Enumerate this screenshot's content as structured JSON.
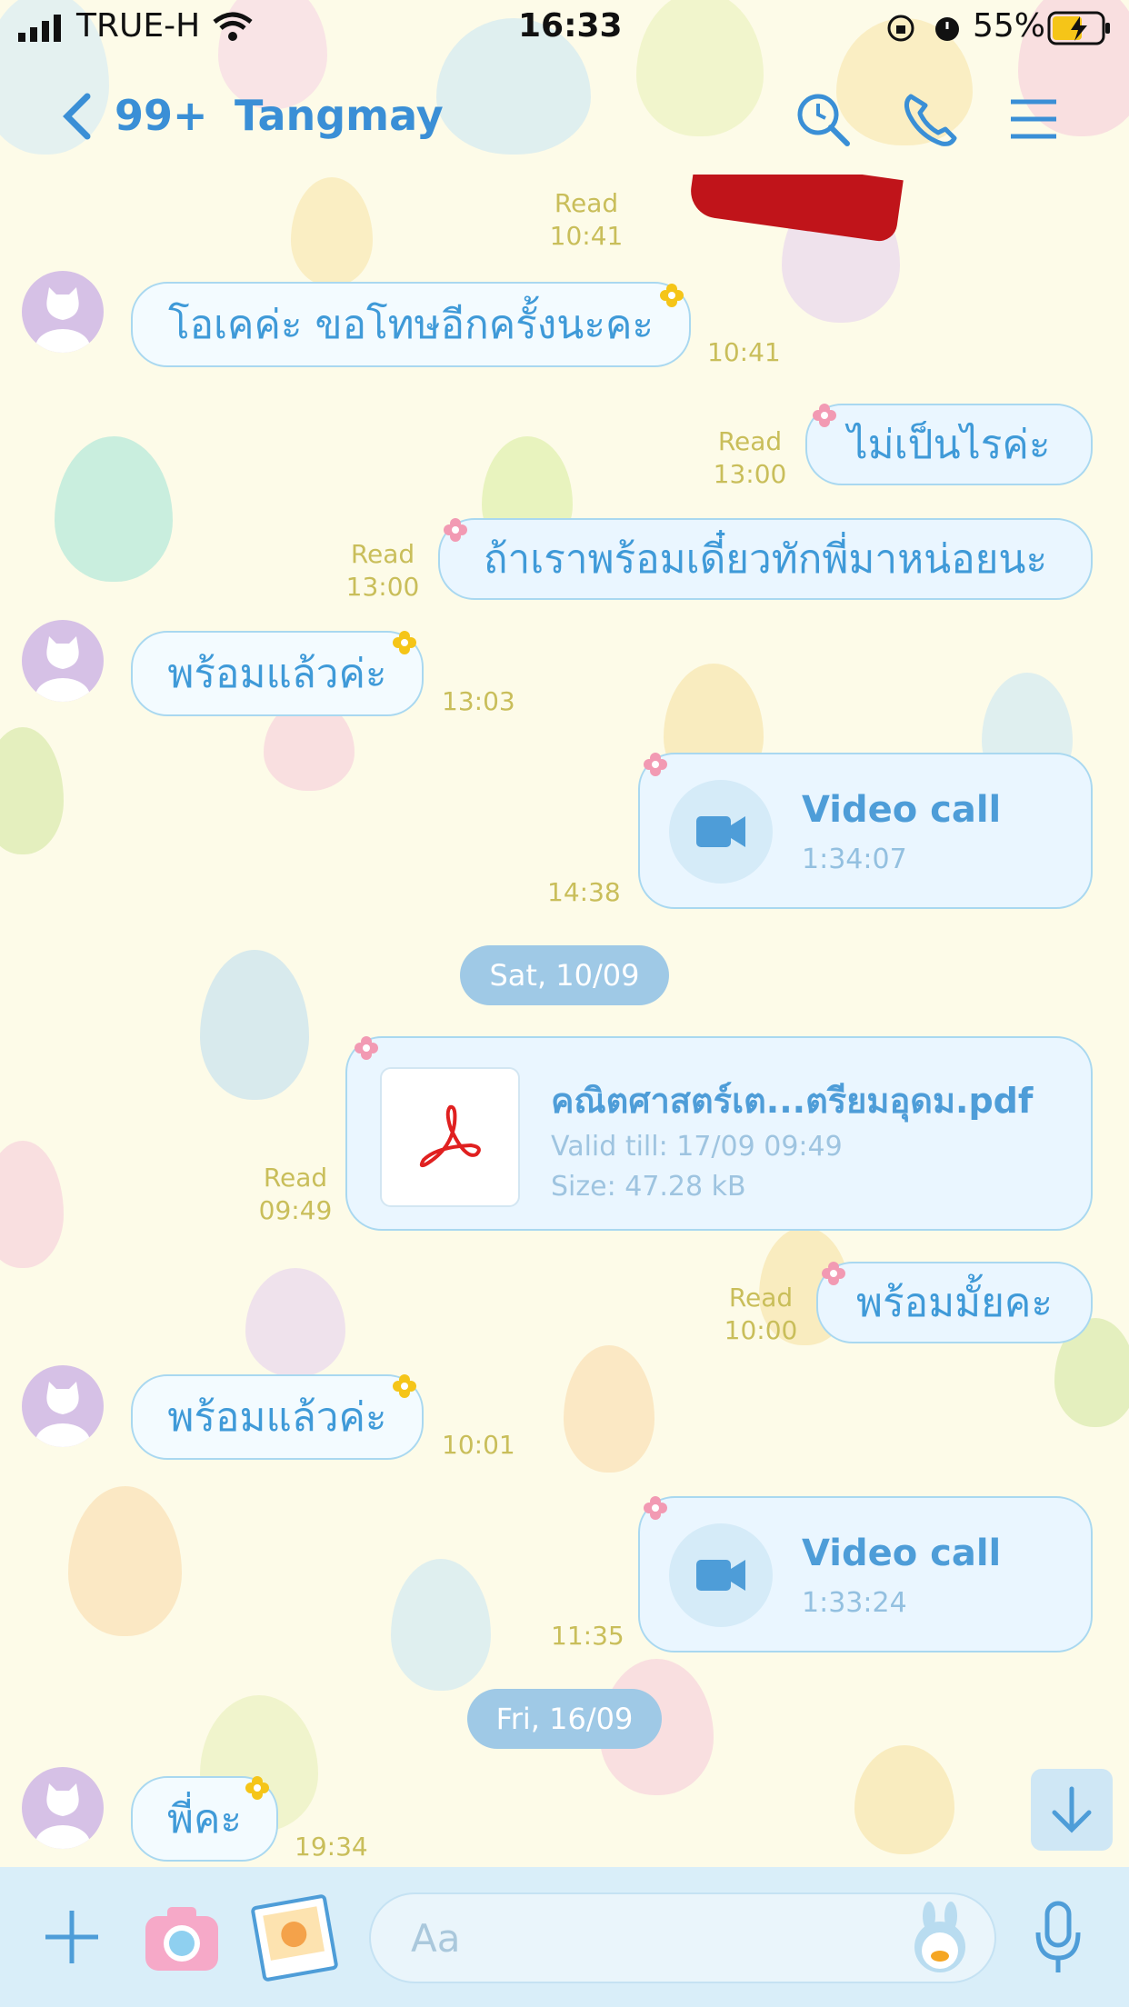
{
  "status_bar": {
    "carrier": "TRUE-H",
    "time": "16:33",
    "battery": "55%"
  },
  "header": {
    "back_count": "99+",
    "contact_name": "Tangmay",
    "icons": [
      "search-icon",
      "phone-icon",
      "menu-icon"
    ]
  },
  "messages": {
    "m1": {
      "read": "Read",
      "time": "10:41"
    },
    "m2": {
      "text": "โอเคค่ะ ขอโทษอีกครั้งนะคะ",
      "time": "10:41"
    },
    "m3": {
      "text": "ไม่เป็นไรค่ะ",
      "read": "Read",
      "time": "13:00"
    },
    "m4": {
      "text": "ถ้าเราพร้อมเดี๋ยวทักพี่มาหน่อยนะ",
      "read": "Read",
      "time": "13:00"
    },
    "m5": {
      "text": "พร้อมแล้วค่ะ",
      "time": "13:03"
    },
    "m6": {
      "title": "Video call",
      "duration": "1:34:07",
      "time": "14:38"
    },
    "date1": "Sat, 10/09",
    "m7": {
      "file_name": "คณิตศาสตร์เต...ตรียมอุดม.pdf",
      "valid": "Valid till: 17/09 09:49",
      "size": "Size: 47.28 kB",
      "read": "Read",
      "time": "09:49"
    },
    "m8": {
      "text": "พร้อมมั้ยคะ",
      "read": "Read",
      "time": "10:00"
    },
    "m9": {
      "text": "พร้อมแล้วค่ะ",
      "time": "10:01"
    },
    "m10": {
      "title": "Video call",
      "duration": "1:33:24",
      "time": "11:35"
    },
    "date2": "Fri, 16/09",
    "m11": {
      "text": "พี่คะ",
      "time": "19:34"
    }
  },
  "input": {
    "placeholder": "Aa"
  },
  "colors": {
    "accent": "#3a8fd6",
    "time_text": "#c9be5a",
    "background": "#fdfbe8"
  }
}
